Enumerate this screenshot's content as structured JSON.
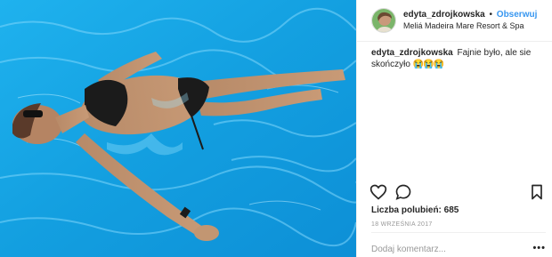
{
  "post": {
    "header": {
      "username": "edyta_zdrojkowska",
      "separator": "•",
      "follow_label": "Obserwuj",
      "location": "Meliá Madeira Mare Resort & Spa"
    },
    "caption": {
      "username": "edyta_zdrojkowska",
      "text": "Fajnie było, ale sie skończyło",
      "emoji": "😭😭😭"
    },
    "actions": {
      "like_icon": "heart-outline-icon",
      "comment_icon": "comment-bubble-icon",
      "save_icon": "bookmark-icon"
    },
    "likes_text": "Liczba polubień: 685",
    "date_text": "18 WRZEŚNIA 2017",
    "comment": {
      "placeholder": "Dodaj komentarz...",
      "more_label": "•••"
    }
  },
  "colors": {
    "pool_blue": "#1aa6e6",
    "follow_blue": "#3897f0",
    "muted_text": "#999999",
    "divider": "#efefef"
  }
}
